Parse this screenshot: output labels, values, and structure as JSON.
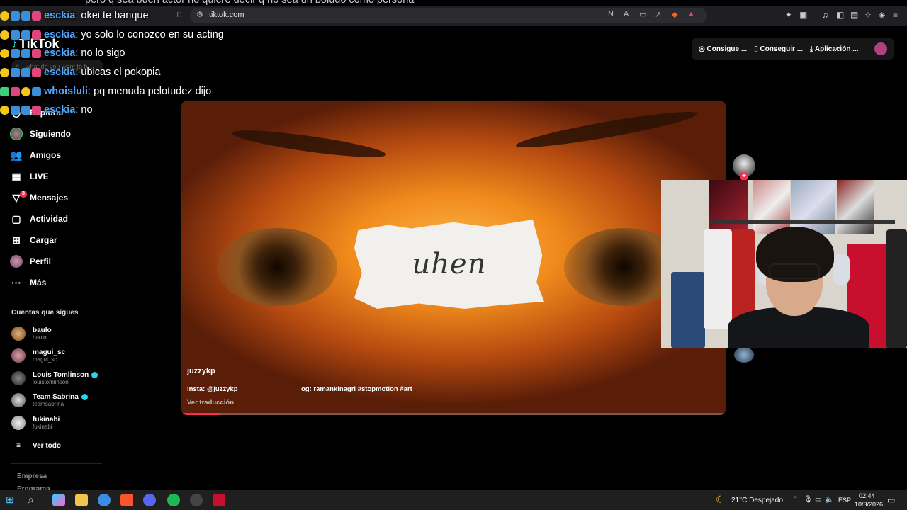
{
  "browser": {
    "url": "tiktok.com",
    "cut_off_line": "pero q sea buen actor no quiere decir q no sea un boludo como persona"
  },
  "chat": {
    "messages": [
      {
        "user": "esckia",
        "text": ": okei te banque"
      },
      {
        "user": "esckia",
        "text": ": yo solo lo conozco en su acting"
      },
      {
        "user": "esckia",
        "text": ": no lo sigo"
      },
      {
        "user": "esckia",
        "text": ": ubicas el pokopia"
      },
      {
        "user": "whoisluli",
        "text": ": pq menuda pelotudez dijo"
      },
      {
        "user": "esckia",
        "text": ": no"
      }
    ]
  },
  "tiktok": {
    "logo": "TikTok",
    "search_placeholder": "what do you want to b...",
    "nav": [
      {
        "label": "Explorar",
        "icon": "compass-icon"
      },
      {
        "label": "Siguiendo",
        "icon": "avatar"
      },
      {
        "label": "Amigos",
        "icon": "friends-icon"
      },
      {
        "label": "LIVE",
        "icon": "live-icon"
      },
      {
        "label": "Mensajes",
        "icon": "messages-icon",
        "badge": "3"
      },
      {
        "label": "Actividad",
        "icon": "activity-icon"
      },
      {
        "label": "Cargar",
        "icon": "upload-icon"
      },
      {
        "label": "Perfil",
        "icon": "avatar"
      },
      {
        "label": "Más",
        "icon": "more-icon"
      }
    ],
    "following_title": "Cuentas que sigues",
    "following": [
      {
        "name": "baulo",
        "handle": "baulol",
        "verified": false
      },
      {
        "name": "magui_sc",
        "handle": "magui_sc",
        "verified": false
      },
      {
        "name": "Louis Tomlinson",
        "handle": "louistomlinson",
        "verified": true
      },
      {
        "name": "Team Sabrina",
        "handle": "teamsabrina",
        "verified": true
      },
      {
        "name": "fukinabi",
        "handle": "fukinabi",
        "verified": false
      }
    ],
    "see_all": "Ver todo",
    "footer": [
      "Empresa",
      "Programa"
    ],
    "top_buttons": [
      "Consigue ...",
      "Conseguir ...",
      "Aplicación ..."
    ],
    "video": {
      "paper_text": "uhen",
      "username": "juzzykp",
      "desc_left": "insta: @juzzykp",
      "desc_right": "og: ramankinagri #stopmotion #art",
      "translate": "Ver traducción",
      "progress": 0.07
    }
  },
  "taskbar": {
    "weather": "21°C  Despejado",
    "language": "ESP",
    "time": "02:44",
    "date": "10/3/2026"
  },
  "colors": {
    "accent": "#fe2c55",
    "chat_user": "#4fa7ff",
    "verified": "#20d5ec"
  }
}
